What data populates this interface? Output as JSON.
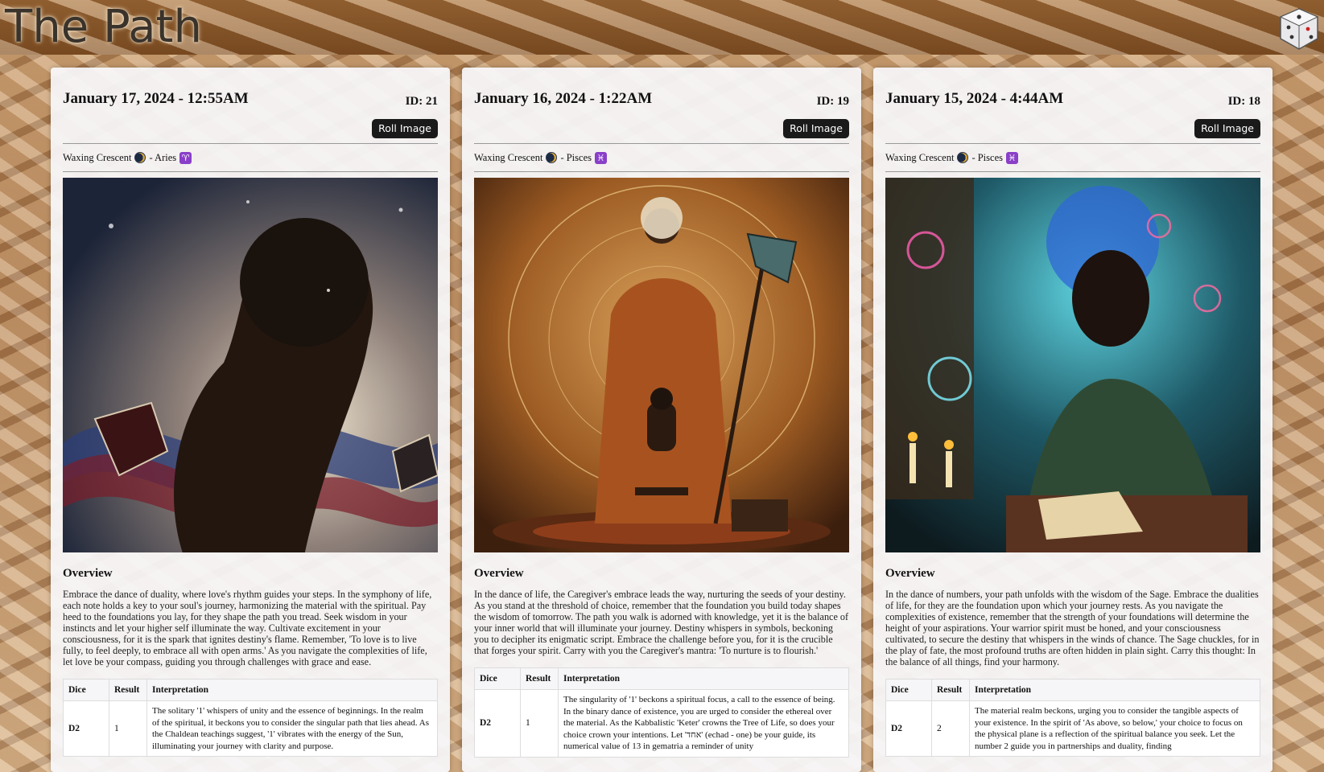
{
  "header": {
    "title": "The Path",
    "dice_icon": "dice-icon"
  },
  "cards": [
    {
      "date": "January 17, 2024 - 12:55AM",
      "id_label": "ID: 21",
      "roll_label": "Roll Image",
      "moon_phase": "Waxing Crescent",
      "sign": "- Aries",
      "sign_glyph": "♈",
      "overview_title": "Overview",
      "overview": "Embrace the dance of duality, where love's rhythm guides your steps. In the symphony of life, each note holds a key to your soul's journey, harmonizing the material with the spiritual. Pay heed to the foundations you lay, for they shape the path you tread. Seek wisdom in your instincts and let your higher self illuminate the way. Cultivate excitement in your consciousness, for it is the spark that ignites destiny's flame. Remember, 'To love is to live fully, to feel deeply, to embrace all with open arms.' As you navigate the complexities of life, let love be your compass, guiding you through challenges with grace and ease.",
      "table": {
        "headers": [
          "Dice",
          "Result",
          "Interpretation"
        ],
        "row": {
          "dice": "D2",
          "result": "1",
          "interpretation": "The solitary '1' whispers of unity and the essence of beginnings. In the realm of the spiritual, it beckons you to consider the singular path that lies ahead. As the Chaldean teachings suggest, '1' vibrates with the energy of the Sun, illuminating your journey with clarity and purpose."
        }
      }
    },
    {
      "date": "January 16, 2024 - 1:22AM",
      "id_label": "ID: 19",
      "roll_label": "Roll Image",
      "moon_phase": "Waxing Crescent",
      "sign": "- Pisces",
      "sign_glyph": "♓",
      "overview_title": "Overview",
      "overview": "In the dance of life, the Caregiver's embrace leads the way, nurturing the seeds of your destiny. As you stand at the threshold of choice, remember that the foundation you build today shapes the wisdom of tomorrow. The path you walk is adorned with knowledge, yet it is the balance of your inner world that will illuminate your journey. Destiny whispers in symbols, beckoning you to decipher its enigmatic script. Embrace the challenge before you, for it is the crucible that forges your spirit. Carry with you the Caregiver's mantra: 'To nurture is to flourish.'",
      "table": {
        "headers": [
          "Dice",
          "Result",
          "Interpretation"
        ],
        "row": {
          "dice": "D2",
          "result": "1",
          "interpretation": "The singularity of '1' beckons a spiritual focus, a call to the essence of being. In the binary dance of existence, you are urged to consider the ethereal over the material. As the Kabbalistic 'Keter' crowns the Tree of Life, so does your choice crown your intentions. Let 'אחד' (echad - one) be your guide, its numerical value of 13 in gematria a reminder of unity"
        }
      }
    },
    {
      "date": "January 15, 2024 - 4:44AM",
      "id_label": "ID: 18",
      "roll_label": "Roll Image",
      "moon_phase": "Waxing Crescent",
      "sign": "- Pisces",
      "sign_glyph": "♓",
      "overview_title": "Overview",
      "overview": "In the dance of numbers, your path unfolds with the wisdom of the Sage. Embrace the dualities of life, for they are the foundation upon which your journey rests. As you navigate the complexities of existence, remember that the strength of your foundations will determine the height of your aspirations. Your warrior spirit must be honed, and your consciousness cultivated, to secure the destiny that whispers in the winds of chance. The Sage chuckles, for in the play of fate, the most profound truths are often hidden in plain sight. Carry this thought: In the balance of all things, find your harmony.",
      "table": {
        "headers": [
          "Dice",
          "Result",
          "Interpretation"
        ],
        "row": {
          "dice": "D2",
          "result": "2",
          "interpretation": "The material realm beckons, urging you to consider the tangible aspects of your existence. In the spirit of 'As above, so below,' your choice to focus on the physical plane is a reflection of the spiritual balance you seek. Let the number 2 guide you in partnerships and duality, finding"
        }
      }
    }
  ]
}
